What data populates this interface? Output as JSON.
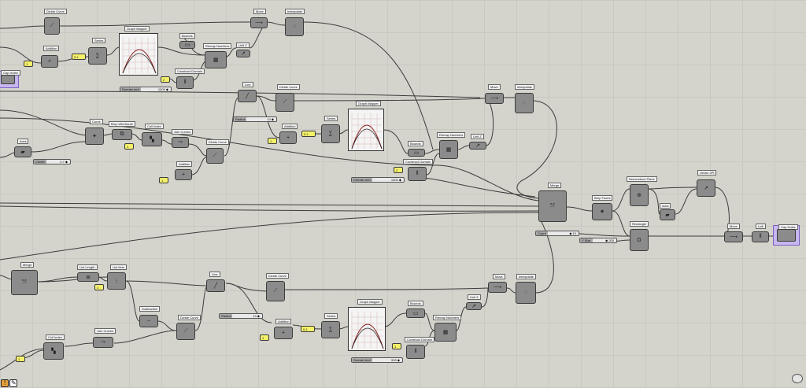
{
  "canvas": {
    "accent_node": "#8b8b8b",
    "wire": "#3c3c3c",
    "panel_yellow": "#f3f06a",
    "cluster_purple": "#c7b6ef"
  },
  "labels": {
    "divide_curve_1": "Divide Curve",
    "move_1": "Move",
    "interpolate_1": "Interpolate",
    "series_1": "Series",
    "graph_mapper_1": "Graph Mapper",
    "bounds_1": "Bounds",
    "remap_1": "Remap Numbers",
    "line2_1": "Unit Z",
    "addition_1": "Addition",
    "construct_domain_1": "Construct Domain",
    "cap_holes_1": "Cap Holes",
    "line_1": "Line",
    "divide_curve_2": "Divide Curve",
    "move_2": "Move",
    "interpolate_2": "Interpolate",
    "curve_mid": "Curve",
    "brep_wireframe": "Brep Wireframe",
    "cull_index_1": "Cull Index",
    "join_curves_1": "Join Curves",
    "area_1": "Area",
    "addition_2": "Addition",
    "series_2": "Series",
    "graph_mapper_2": "Graph Mapper",
    "bounds_2": "Bounds",
    "remap_2": "Remap Numbers",
    "line2_2": "Unit Z",
    "construct_domain_2": "Construct Domain",
    "addition_3": "Addition",
    "divide_curve_3": "Divide Curve",
    "merge": "Merge",
    "brep_faces": "Brep Faces",
    "deconstruct_plane": "Deconstruct Plane",
    "vector_2pt": "Vector 2Pt",
    "area_2": "Area",
    "rectangle": "Rectangle",
    "move_3": "Move",
    "loft": "Loft",
    "cap_holes_2": "Cap Holes",
    "merge2": "Merge",
    "list_length": "List Length",
    "list_item": "List Item",
    "line_3": "Line",
    "subtraction": "Subtraction",
    "divide_curve_4": "Divide Curve",
    "divide_curve_5": "Divide Curve",
    "cull_index_2": "Cull Index",
    "join_curves_2": "Join Curves",
    "addition_4": "Addition",
    "series_3": "Series",
    "graph_mapper_3": "Graph Mapper",
    "bounds_3": "Bounds",
    "remap_3": "Remap Numbers",
    "line2_3": "Unit Z",
    "construct_domain_3": "Construct Domain",
    "move_4": "Move",
    "interpolate_3": "Interpolate"
  },
  "panels": {
    "p1": "1",
    "p2": "0.1",
    "p3": "2",
    "p4": "1",
    "p5": "1",
    "p6": "0.1",
    "p7": "1",
    "p8": "2",
    "p9": "1",
    "p10": "1",
    "p11": "0.1",
    "p12": "1",
    "p13": "1",
    "p14": "1"
  },
  "sliders": {
    "s1": {
      "name": "Domain end",
      "value": "1000 ◆"
    },
    "s2": {
      "name": "Center",
      "value": "0.7 ◆"
    },
    "s3": {
      "name": "Radius",
      "value": "10 ◆"
    },
    "s4": {
      "name": "Domain end",
      "value": "1000 ◆"
    },
    "s5": {
      "name": "Count",
      "value": "◆ 10"
    },
    "s6": {
      "name": "Y Size",
      "value": "◆ 200"
    },
    "s7": {
      "name": "Radius",
      "value": "10 ◆"
    },
    "s8": {
      "name": "Domain end",
      "value": "500 ◆"
    }
  },
  "icons": {
    "warning": "warning-icon",
    "pen": "pencil-icon",
    "camera": "camera-icon"
  }
}
